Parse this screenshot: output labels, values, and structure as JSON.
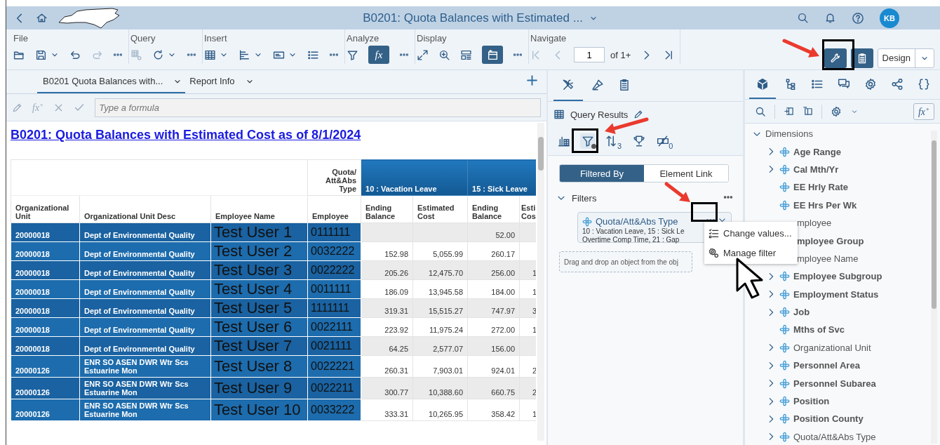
{
  "shell": {
    "title": "B0201: Quota Balances with Estimated ...",
    "avatar": "KB"
  },
  "toolbar": {
    "groups": [
      {
        "label": "File",
        "tools": [
          {
            "kind": "open",
            "on": false,
            "disabled": false
          },
          {
            "kind": "save",
            "on": false,
            "disabled": false
          },
          {
            "kind": "dropdown",
            "on": false,
            "disabled": false
          },
          {
            "kind": "undo",
            "on": false,
            "disabled": false
          },
          {
            "kind": "redo",
            "on": false,
            "disabled": true
          },
          {
            "kind": "more",
            "on": false,
            "disabled": false
          }
        ]
      },
      {
        "label": "Query",
        "tools": [
          {
            "kind": "grid-gear",
            "on": false,
            "disabled": true
          },
          {
            "kind": "refresh",
            "on": false,
            "disabled": false
          },
          {
            "kind": "dropdown",
            "on": false,
            "disabled": false
          },
          {
            "kind": "more",
            "on": false,
            "disabled": false
          }
        ]
      },
      {
        "label": "Insert",
        "tools": [
          {
            "kind": "table",
            "on": false,
            "disabled": false
          },
          {
            "kind": "dropdown",
            "on": false,
            "disabled": false
          },
          {
            "kind": "bars",
            "on": false,
            "disabled": false
          },
          {
            "kind": "dropdown",
            "on": false,
            "disabled": false
          },
          {
            "kind": "textbox",
            "on": false,
            "disabled": false
          },
          {
            "kind": "dropdown",
            "on": false,
            "disabled": false
          },
          {
            "kind": "list",
            "on": false,
            "disabled": false
          },
          {
            "kind": "more",
            "on": false,
            "disabled": false
          }
        ]
      },
      {
        "label": "Analyze",
        "tools": [
          {
            "kind": "filter",
            "on": false,
            "disabled": false
          },
          {
            "kind": "formula",
            "text": "fx",
            "on": true,
            "disabled": false
          },
          {
            "kind": "more",
            "on": false,
            "disabled": false
          }
        ]
      },
      {
        "label": "Display",
        "tools": [
          {
            "kind": "expand",
            "on": false,
            "disabled": false
          },
          {
            "kind": "zoom",
            "on": false,
            "disabled": false
          },
          {
            "kind": "layout",
            "on": false,
            "disabled": false
          },
          {
            "kind": "panel",
            "on": true,
            "disabled": false
          },
          {
            "kind": "more",
            "on": false,
            "disabled": false
          }
        ]
      },
      {
        "label": "Navigate",
        "tools": [
          {
            "kind": "first",
            "on": false,
            "disabled": true
          },
          {
            "kind": "prev",
            "on": false,
            "disabled": true
          }
        ],
        "pager": {
          "value": "1",
          "count": "of 1+"
        },
        "tools_after": [
          {
            "kind": "next",
            "on": false,
            "disabled": false
          },
          {
            "kind": "last",
            "on": false,
            "disabled": false
          }
        ]
      }
    ],
    "modes": [
      {
        "kind": "wrench",
        "on": true
      },
      {
        "kind": "clipboard",
        "on": true
      }
    ],
    "design": "Design"
  },
  "report": {
    "tabs": [
      {
        "label": "B0201 Quota Balances with...",
        "selected": true
      },
      {
        "label": "Report Info",
        "selected": false
      }
    ],
    "formula_icon": "fx$^{+}$",
    "formula_placeholder": "Type a formula",
    "title": "B0201: Quota Balances with Estimated Cost as of 8/1/2024",
    "table": {
      "corner_header": "Quota/ Att&Abs Type",
      "groups": [
        "10 : Vacation Leave",
        "15 : Sick Leave"
      ],
      "columns": [
        "Organizational Unit",
        "Organizational Unit Desc",
        "Employee Name",
        "Employee",
        "Ending Balance",
        "Estimated Cost",
        "Ending Balance",
        "Esti Cos"
      ],
      "rows": [
        {
          "cells": [
            "20000018",
            "Dept of Environmental Quality",
            "Test User 1",
            "0111111",
            null,
            null,
            "52.00",
            null
          ]
        },
        {
          "cells": [
            "20000018",
            "Dept of Environmental Quality",
            "Test User 2",
            "0032222",
            "152.98",
            "5,055.99",
            "260.17",
            null
          ]
        },
        {
          "cells": [
            "20000018",
            "Dept of Environmental Quality",
            "Test User 3",
            "0022222",
            "205.26",
            "12,475.70",
            "256.00",
            "1"
          ]
        },
        {
          "cells": [
            "20000018",
            "Dept of Environmental Quality",
            "Test User 4",
            "0011111",
            "186.09",
            "13,945.58",
            "184.00",
            "1"
          ]
        },
        {
          "cells": [
            "20000018",
            "Dept of Environmental Quality",
            "Test User 5",
            "1111111",
            "319.31",
            "15,515.27",
            "747.97",
            "3"
          ]
        },
        {
          "cells": [
            "20000018",
            "Dept of Environmental Quality",
            "Test User 6",
            "0022111",
            "223.92",
            "11,975.24",
            "272.00",
            "1"
          ]
        },
        {
          "cells": [
            "20000018",
            "Dept of Environmental Quality",
            "Test User 7",
            "0021111",
            "64.25",
            "2,577.07",
            "156.00",
            null
          ]
        },
        {
          "cells": [
            "20000126",
            "ENR SO ASEN DWR Wtr Scs Estuarine Mon",
            "Test User 8",
            "0022221",
            "260.31",
            "7,903.01",
            "924.01",
            "2"
          ]
        },
        {
          "cells": [
            "20000126",
            "ENR SO ASEN DWR Wtr Scs Estuarine Mon",
            "Test User 9",
            "0022211",
            "300.77",
            "10,388.60",
            "660.75",
            "2"
          ]
        },
        {
          "cells": [
            "20000126",
            "ENR SO ASEN DWR Wtr Scs Estuarine Mon",
            "Test User 10",
            "0033222",
            "333.31",
            "10,265.95",
            "358.42",
            "1"
          ]
        }
      ]
    }
  },
  "query_panel": {
    "tabs": [
      {
        "kind": "tools",
        "selected": true
      },
      {
        "kind": "brush",
        "selected": false
      },
      {
        "kind": "notes",
        "selected": false
      }
    ],
    "source": "Query Results",
    "views": [
      {
        "kind": "chart-table",
        "selected": false
      },
      {
        "kind": "filter",
        "selected": true
      },
      {
        "kind": "sort",
        "count": "3",
        "selected": false
      },
      {
        "kind": "ranking",
        "selected": false
      },
      {
        "kind": "conditional",
        "count": "0",
        "selected": false
      }
    ],
    "segments": [
      {
        "label": "Filtered By",
        "selected": true
      },
      {
        "label": "Element Link",
        "selected": false
      }
    ],
    "section": {
      "label": "Filters",
      "expanded": true
    },
    "filter": {
      "name": "Quota/Att&Abs Type",
      "lines": [
        "10 : Vacation Leave, 15 : Sick Le",
        "Overtime Comp Time, 21 : Gap"
      ]
    },
    "dropzone": "Drag and drop an object from the obj",
    "menu": [
      {
        "kind": "checklist",
        "label": "Change values..."
      },
      {
        "kind": "gears",
        "label": "Manage filter"
      }
    ]
  },
  "outline_panel": {
    "tabs": [
      {
        "kind": "cube",
        "selected": true
      },
      {
        "kind": "hierarchy",
        "selected": false
      },
      {
        "kind": "list",
        "selected": false
      },
      {
        "kind": "chat",
        "selected": false
      },
      {
        "kind": "gear",
        "selected": false
      },
      {
        "kind": "share",
        "selected": false
      },
      {
        "kind": "braces",
        "selected": false
      }
    ],
    "formula_button": "fx$^{+}$",
    "tree": {
      "label": "Dimensions",
      "expanded": true,
      "children": [
        {
          "label": "Age Range",
          "kind": "group",
          "emphasized": true
        },
        {
          "label": "Cal Mth/Yr",
          "kind": "group",
          "emphasized": true
        },
        {
          "label": "EE Hrly Rate",
          "kind": "leaf",
          "emphasized": true
        },
        {
          "label": "EE Hrs Per Wk",
          "kind": "leaf",
          "emphasized": true
        },
        {
          "label": "mployee",
          "kind": "covered",
          "emphasized": false
        },
        {
          "label": "mployee Group",
          "kind": "covered",
          "emphasized": true
        },
        {
          "label": "mployee Name",
          "kind": "covered",
          "emphasized": false
        },
        {
          "label": "Employee Subgroup",
          "kind": "group",
          "emphasized": true
        },
        {
          "label": "Employment Status",
          "kind": "group",
          "emphasized": true
        },
        {
          "label": "Job",
          "kind": "group",
          "emphasized": true
        },
        {
          "label": "Mths of Svc",
          "kind": "leaf",
          "emphasized": true
        },
        {
          "label": "Organizational Unit",
          "kind": "group",
          "emphasized": false
        },
        {
          "label": "Personnel Area",
          "kind": "group",
          "emphasized": true
        },
        {
          "label": "Personnel Subarea",
          "kind": "group",
          "emphasized": true
        },
        {
          "label": "Position",
          "kind": "group",
          "emphasized": true
        },
        {
          "label": "Position County",
          "kind": "group",
          "emphasized": true
        },
        {
          "label": "Quota/Att&Abs Type",
          "kind": "group",
          "emphasized": false
        }
      ]
    }
  }
}
